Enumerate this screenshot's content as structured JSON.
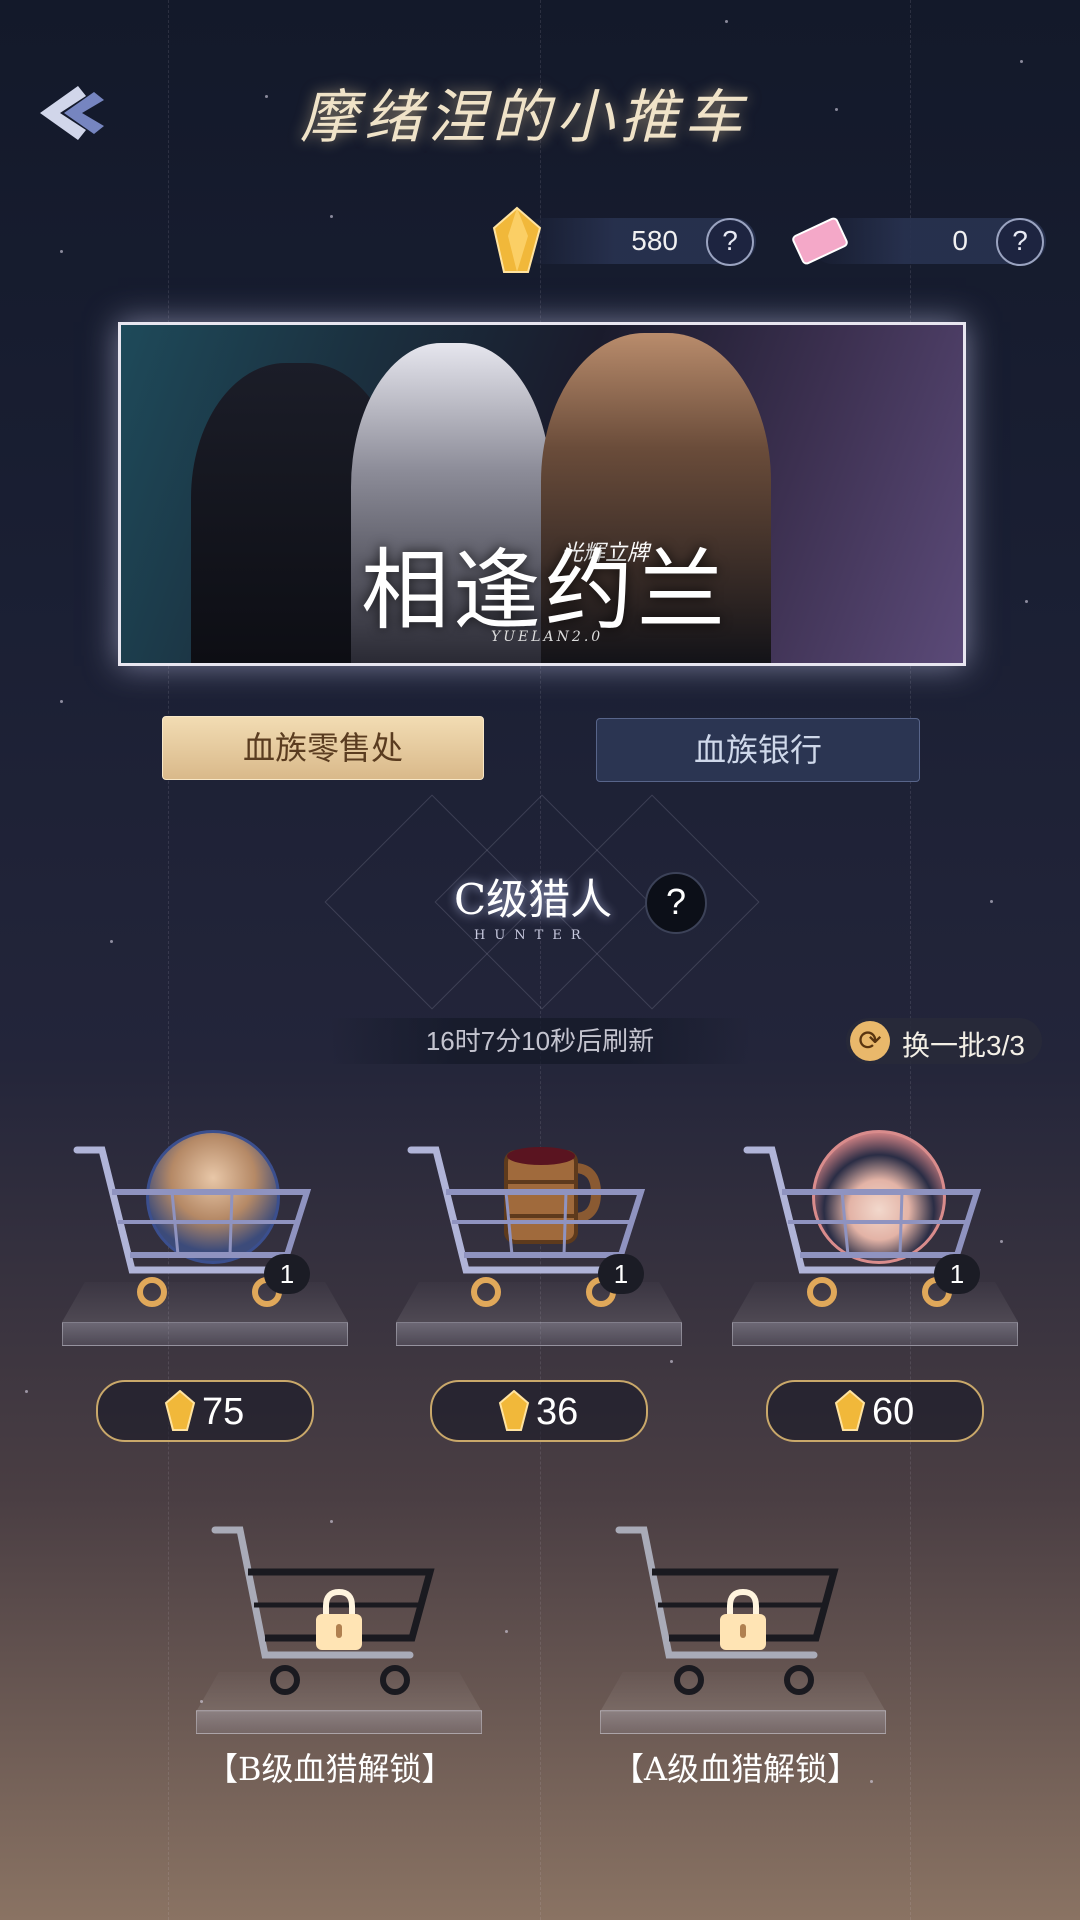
{
  "header": {
    "title": "摩绪涅的小推车"
  },
  "currency": [
    {
      "icon": "gold-crystal-icon",
      "value": "580"
    },
    {
      "icon": "ticket-icon",
      "value": "0"
    }
  ],
  "help_glyph": "?",
  "banner": {
    "tag": "光辉立牌",
    "title": "相逢约兰",
    "subtitle": "YUELAN2.0"
  },
  "tabs": [
    {
      "label": "血族零售处",
      "active": true
    },
    {
      "label": "血族银行",
      "active": false
    }
  ],
  "rank": {
    "label": "C级猎人",
    "sub": "HUNTER"
  },
  "timer": "16时7分10秒后刷新",
  "refresh": {
    "label": "换一批3/3"
  },
  "carts": [
    {
      "item": "portrait-long-hair",
      "qty": "1",
      "price": "75"
    },
    {
      "item": "wooden-mug",
      "qty": "1",
      "price": "36"
    },
    {
      "item": "portrait-chibi",
      "qty": "1",
      "price": "60"
    }
  ],
  "locked": [
    {
      "label": "【B级血猎解锁】"
    },
    {
      "label": "【A级血猎解锁】"
    }
  ],
  "colors": {
    "accent_gold": "#c9a86a",
    "tab_active": "#e6c799",
    "crystal": "#f1b83a"
  }
}
